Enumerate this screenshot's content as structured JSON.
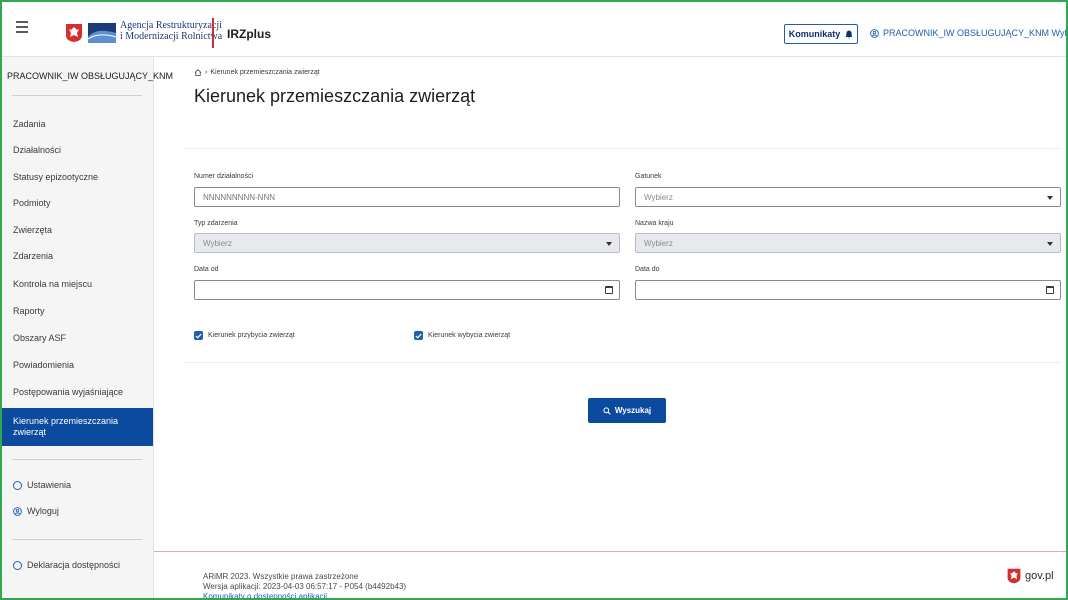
{
  "header": {
    "agency_line1": "Agencja Restrukturyzacji",
    "agency_line2": "i Modernizacji Rolnictwa",
    "app_title": "IRZplus",
    "announcements_label": "Komunikaty",
    "user_text": "PRACOWNIK_IW OBSŁUGUJĄCY_KNM Wyloguj"
  },
  "sidebar": {
    "user": "PRACOWNIK_IW OBSŁUGUJĄCY_KNM",
    "items": [
      {
        "label": "Zadania"
      },
      {
        "label": "Działalności"
      },
      {
        "label": "Statusy epizootyczne"
      },
      {
        "label": "Podmioty"
      },
      {
        "label": "Zwierzęta"
      },
      {
        "label": "Zdarzenia"
      },
      {
        "label": "Kontrola na miejscu"
      },
      {
        "label": "Raporty"
      },
      {
        "label": "Obszary ASF"
      },
      {
        "label": "Powiadomienia"
      },
      {
        "label": "Postępowania wyjaśniające"
      },
      {
        "label": "Kierunek przemieszczania zwierząt",
        "active": true
      }
    ],
    "settings": "Ustawienia",
    "logout": "Wyloguj",
    "accessibility": "Deklaracja dostępności"
  },
  "main": {
    "breadcrumb": "Kierunek przemieszczania zwierząt",
    "title": "Kierunek przemieszczania zwierząt",
    "form": {
      "numer_label": "Numer działalności",
      "numer_placeholder": "NNNNNNNNN-NNN",
      "gatunek_label": "Gatunek",
      "gatunek_value": "Wybierz",
      "typ_label": "Typ zdarzenia",
      "typ_value": "Wybierz",
      "kraj_label": "Nazwa kraju",
      "kraj_value": "Wybierz",
      "data_od_label": "Data od",
      "data_do_label": "Data do",
      "chk_przybycia": "Kierunek przybycia zwierząt",
      "chk_wybycia": "Kierunek wybycia zwierząt",
      "search_label": "Wyszukaj"
    }
  },
  "footer": {
    "copyright": "ARiMR 2023. Wszystkie prawa zastrzeżone",
    "version": "Wersja aplikacji: 2023-04-03 06:57:17 - P054 (b4492b43)",
    "link": "Komunikaty o dostępności aplikacji",
    "gov": "gov.pl"
  },
  "colors": {
    "primary": "#0c4a9e",
    "accent_red": "#d32f2f",
    "frame_green": "#2fa84f"
  }
}
